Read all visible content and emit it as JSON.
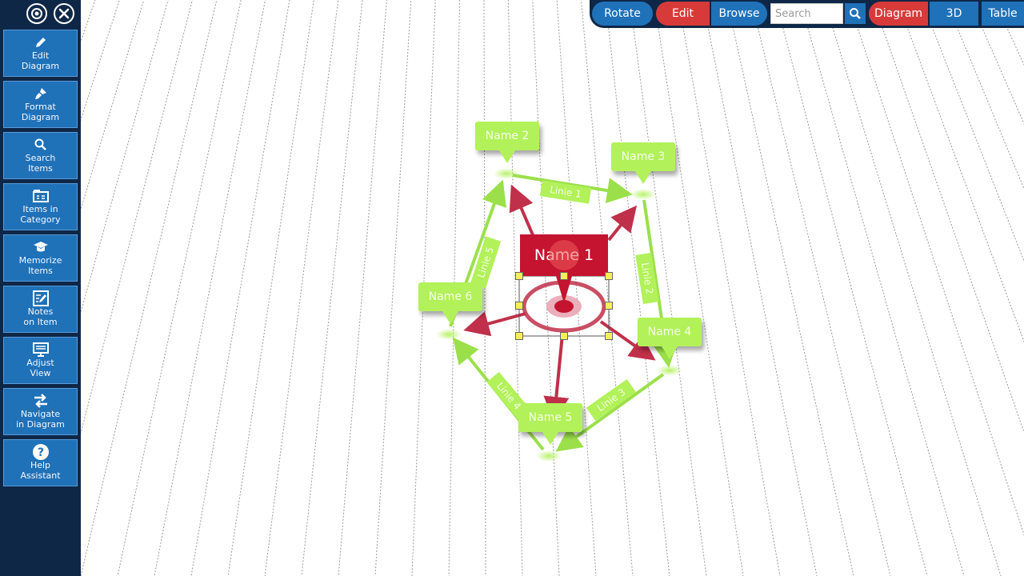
{
  "sidebar": {
    "items": [
      {
        "label": "Edit\nDiagram",
        "icon": "pencil-icon"
      },
      {
        "label": "Format\nDiagram",
        "icon": "brush-icon"
      },
      {
        "label": "Search\nItems",
        "icon": "search-icon"
      },
      {
        "label": "Items in\nCategory",
        "icon": "category-icon"
      },
      {
        "label": "Memorize\nItems",
        "icon": "graduation-cap-icon"
      },
      {
        "label": "Notes\non Item",
        "icon": "notes-icon"
      },
      {
        "label": "Adjust\nView",
        "icon": "monitor-icon"
      },
      {
        "label": "Navigate\nin Diagram",
        "icon": "swap-arrows-icon"
      },
      {
        "label": "Help\nAssistant",
        "icon": "help-icon"
      }
    ]
  },
  "toolbar": {
    "rotate": "Rotate",
    "edit": "Edit",
    "browse": "Browse",
    "search_placeholder": "Search",
    "diagram": "Diagram",
    "three_d": "3D",
    "table": "Table"
  },
  "diagram": {
    "main_node": "Name 1",
    "nodes": [
      "Name 2",
      "Name 3",
      "Name 4",
      "Name 5",
      "Name 6"
    ],
    "edge_labels": [
      "Linie 1",
      "Linie 2",
      "Linie 3",
      "Linie 4",
      "Linie 5"
    ]
  },
  "colors": {
    "sidebar_bg": "#0f2747",
    "button_blue": "#1f71b8",
    "button_red": "#d83a3a",
    "node_green": "#b2f15a",
    "node_red": "#c4142f",
    "arrow_red": "#c0304a",
    "arrow_green": "#9be04a"
  }
}
